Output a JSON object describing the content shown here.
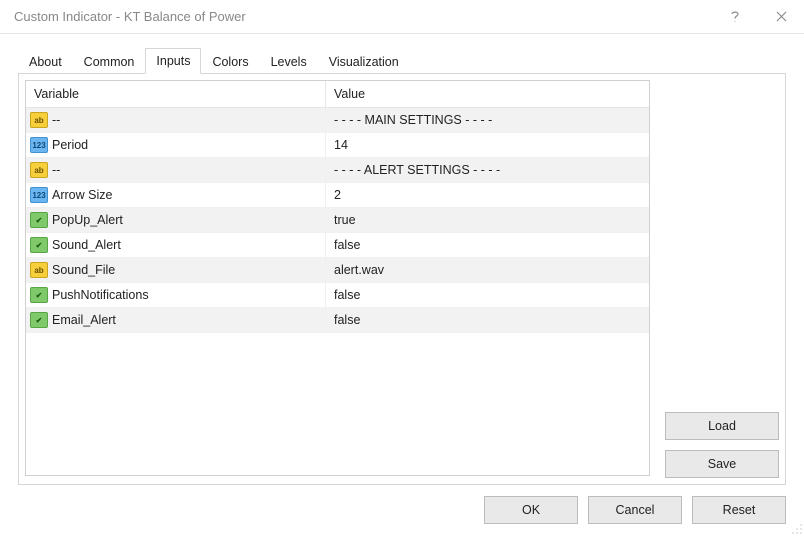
{
  "window": {
    "title": "Custom Indicator - KT Balance of Power"
  },
  "tabs": {
    "about": "About",
    "common": "Common",
    "inputs": "Inputs",
    "colors": "Colors",
    "levels": "Levels",
    "visualization": "Visualization"
  },
  "gridHeaders": {
    "variable": "Variable",
    "value": "Value"
  },
  "rows": [
    {
      "iconType": "str",
      "iconText": "ab",
      "variable": "--",
      "value": "- - - - MAIN SETTINGS - - - -"
    },
    {
      "iconType": "int",
      "iconText": "123",
      "variable": "Period",
      "value": "14"
    },
    {
      "iconType": "str",
      "iconText": "ab",
      "variable": "--",
      "value": "- - - - ALERT SETTINGS - - - -"
    },
    {
      "iconType": "int",
      "iconText": "123",
      "variable": "Arrow Size",
      "value": "2"
    },
    {
      "iconType": "bool",
      "iconText": "✔",
      "variable": "PopUp_Alert",
      "value": "true"
    },
    {
      "iconType": "bool",
      "iconText": "✔",
      "variable": "Sound_Alert",
      "value": "false"
    },
    {
      "iconType": "str",
      "iconText": "ab",
      "variable": "Sound_File",
      "value": "alert.wav"
    },
    {
      "iconType": "bool",
      "iconText": "✔",
      "variable": "PushNotifications",
      "value": "false"
    },
    {
      "iconType": "bool",
      "iconText": "✔",
      "variable": "Email_Alert",
      "value": "false"
    }
  ],
  "buttons": {
    "load": "Load",
    "save": "Save",
    "ok": "OK",
    "cancel": "Cancel",
    "reset": "Reset"
  }
}
